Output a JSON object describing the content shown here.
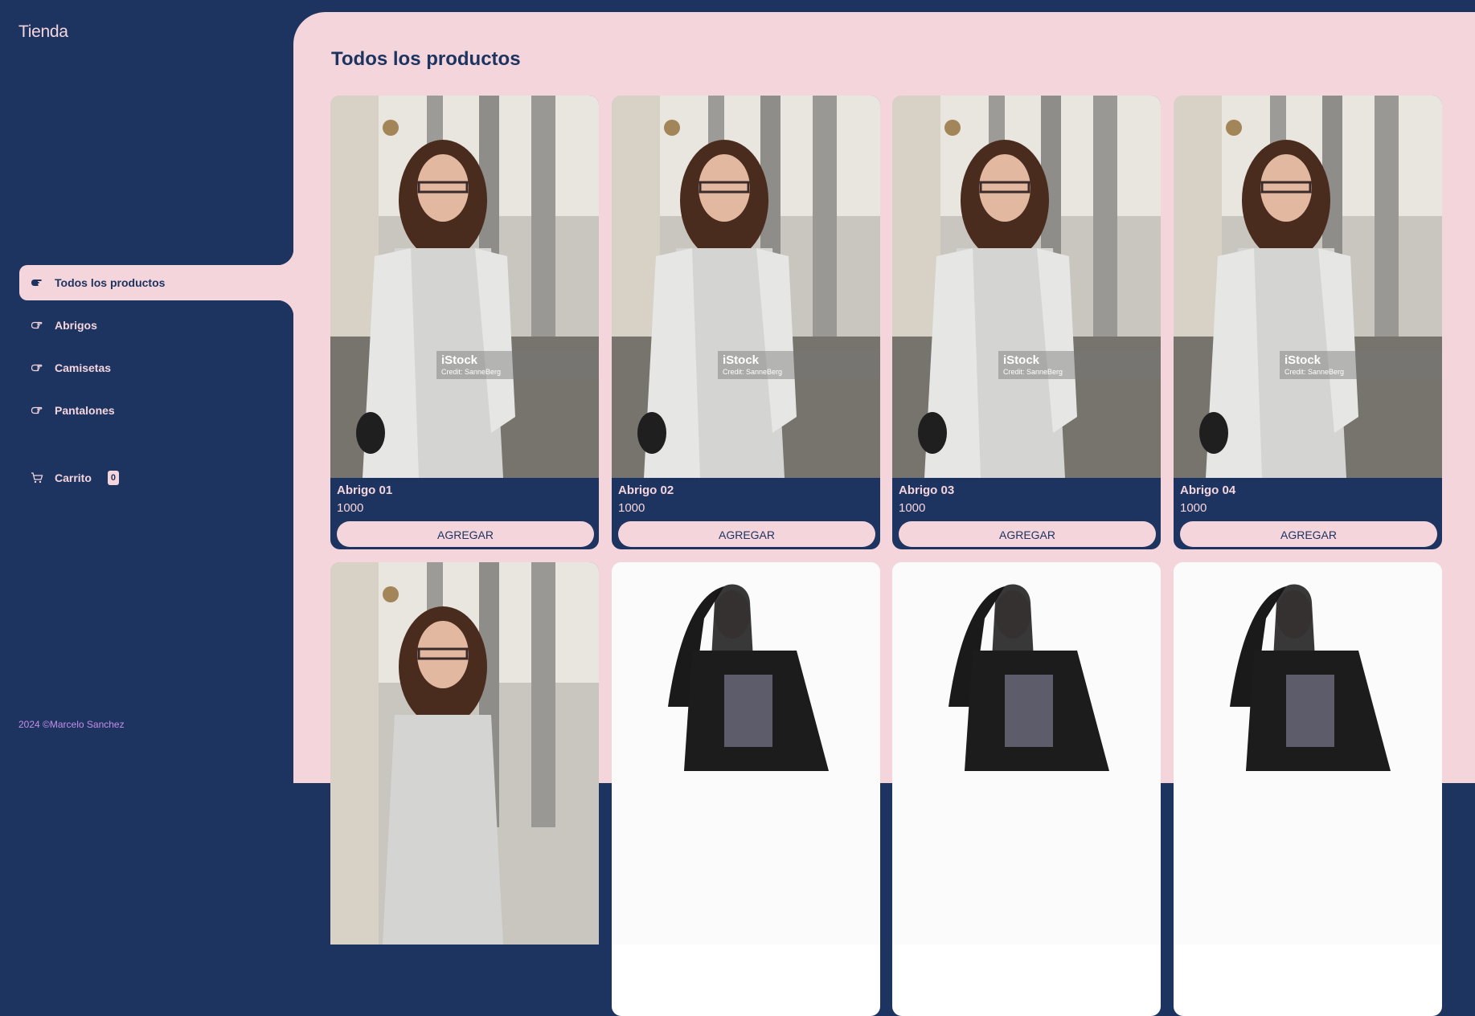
{
  "app": {
    "title": "Tienda"
  },
  "sidebar": {
    "items": [
      {
        "label": "Todos los productos",
        "active": true
      },
      {
        "label": "Abrigos",
        "active": false
      },
      {
        "label": "Camisetas",
        "active": false
      },
      {
        "label": "Pantalones",
        "active": false
      }
    ],
    "cart": {
      "label": "Carrito",
      "count": "0"
    },
    "footer": "2024 ©Marcelo Sanchez"
  },
  "main": {
    "title": "Todos los productos",
    "products": [
      {
        "name": "Abrigo 01",
        "price": "1000",
        "button": "AGREGAR",
        "image": "woman-grey-coat-phone",
        "watermark": {
          "logo": "iStock",
          "credit": "Credit: SanneBerg"
        }
      },
      {
        "name": "Abrigo 02",
        "price": "1000",
        "button": "AGREGAR",
        "image": "woman-grey-coat-phone",
        "watermark": {
          "logo": "iStock",
          "credit": "Credit: SanneBerg"
        }
      },
      {
        "name": "Abrigo 03",
        "price": "1000",
        "button": "AGREGAR",
        "image": "woman-grey-coat-phone",
        "watermark": {
          "logo": "iStock",
          "credit": "Credit: SanneBerg"
        }
      },
      {
        "name": "Abrigo 04",
        "price": "1000",
        "button": "AGREGAR",
        "image": "woman-grey-coat-phone",
        "watermark": {
          "logo": "iStock",
          "credit": "Credit: SanneBerg"
        }
      },
      {
        "image": "woman-grey-coat-phone"
      },
      {
        "image": "woman-black-tshirt"
      },
      {
        "image": "woman-black-tshirt"
      },
      {
        "image": "woman-black-tshirt"
      }
    ]
  },
  "colors": {
    "navy": "#1d3461",
    "pink": "#f5d5dc",
    "footer_purple": "#c48de8"
  }
}
